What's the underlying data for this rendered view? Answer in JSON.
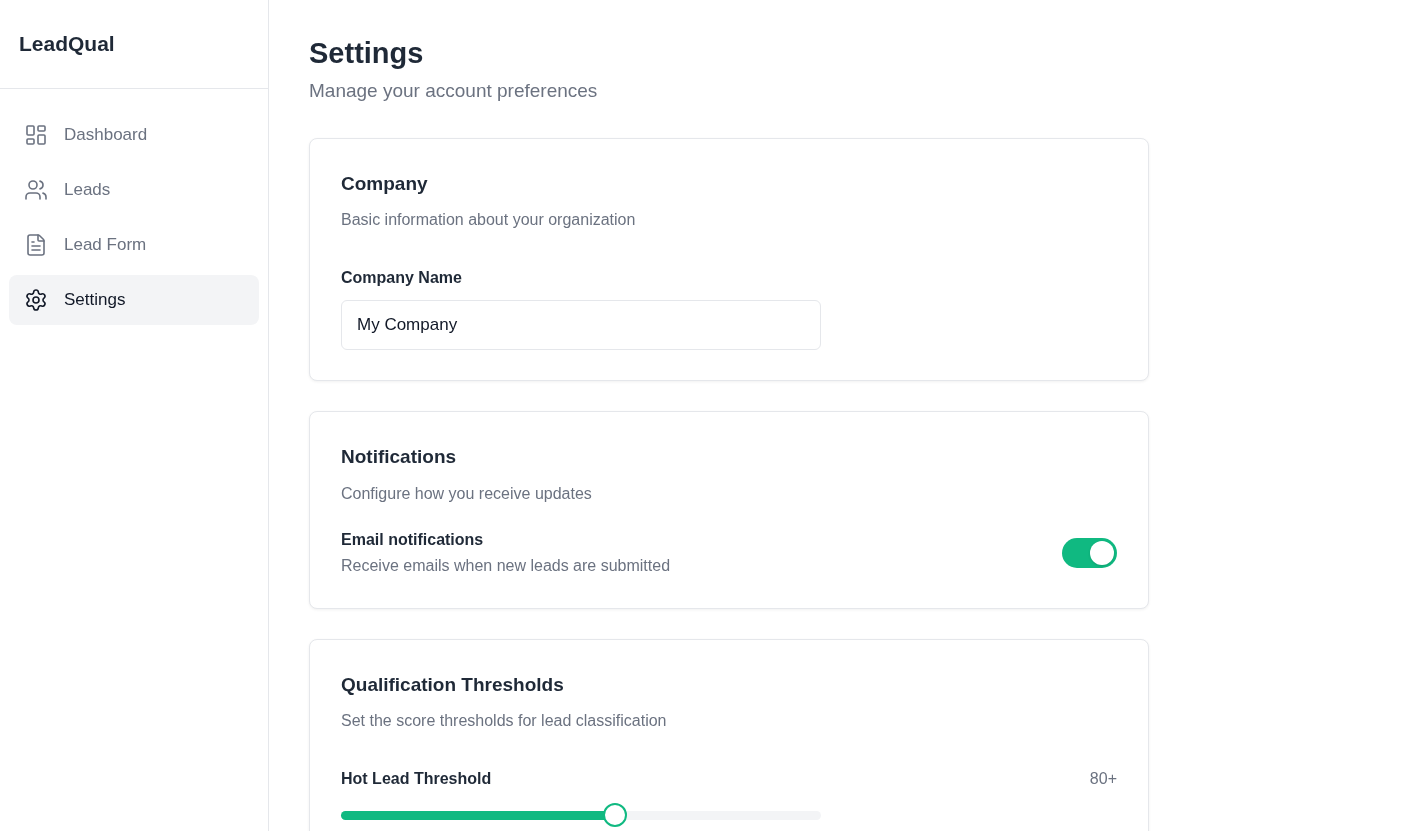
{
  "brand": "LeadQual",
  "nav": [
    {
      "label": "Dashboard",
      "kind": "dashboard",
      "selected": false
    },
    {
      "label": "Leads",
      "kind": "users",
      "selected": false
    },
    {
      "label": "Lead Form",
      "kind": "file",
      "selected": false
    },
    {
      "label": "Settings",
      "kind": "gear",
      "selected": true
    }
  ],
  "page": {
    "title": "Settings",
    "subtitle": "Manage your account preferences"
  },
  "company": {
    "title": "Company",
    "description": "Basic information about your organization",
    "field_label": "Company Name",
    "value": "My Company"
  },
  "notifications": {
    "title": "Notifications",
    "description": "Configure how you receive updates",
    "setting_label": "Email notifications",
    "setting_description": "Receive emails when new leads are submitted",
    "on": true
  },
  "thresholds": {
    "title": "Qualification Thresholds",
    "description": "Set the score thresholds for lead classification",
    "sliders": [
      {
        "label": "Hot Lead Threshold",
        "reading": "80+",
        "level": 0.57
      }
    ]
  }
}
